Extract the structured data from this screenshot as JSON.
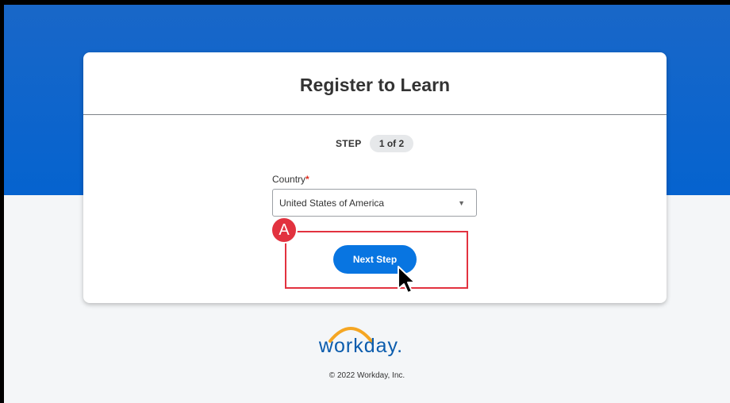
{
  "card": {
    "title": "Register to Learn"
  },
  "step": {
    "label": "STEP",
    "value": "1 of 2"
  },
  "country": {
    "label": "Country",
    "required_marker": "*",
    "selected": "United States of America"
  },
  "actions": {
    "next_label": "Next Step"
  },
  "annotation": {
    "badge_label": "A"
  },
  "footer": {
    "logo_text": "workday.",
    "copyright": "© 2022 Workday, Inc."
  },
  "colors": {
    "brand_blue": "#0563cf",
    "button_blue": "#0875e1",
    "highlight_red": "#e2323f",
    "logo_arc_orange": "#f5a623"
  }
}
